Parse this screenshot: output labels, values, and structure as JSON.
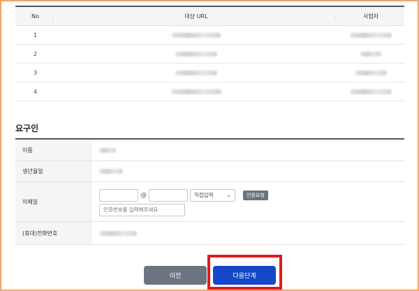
{
  "url_table": {
    "headers": {
      "no": "No",
      "url": "대상 URL",
      "business": "사업자"
    },
    "rows": [
      {
        "no": "1"
      },
      {
        "no": "2"
      },
      {
        "no": "3"
      },
      {
        "no": "4"
      }
    ]
  },
  "requester": {
    "title": "요구인",
    "labels": {
      "name": "이름",
      "birth": "생년월일",
      "email": "이메일",
      "phone": "(휴대)전화번호"
    },
    "email": {
      "at": "@",
      "domain_select": "직접입력",
      "verify_button": "인증요청",
      "code_placeholder": "인증번호를 입력해주세요"
    }
  },
  "buttons": {
    "prev": "이전",
    "next": "다음단계"
  },
  "colors": {
    "frame": "#f2a66a",
    "prev_button": "#6c7480",
    "next_button": "#1548c9",
    "highlight": "#e21b1b"
  }
}
